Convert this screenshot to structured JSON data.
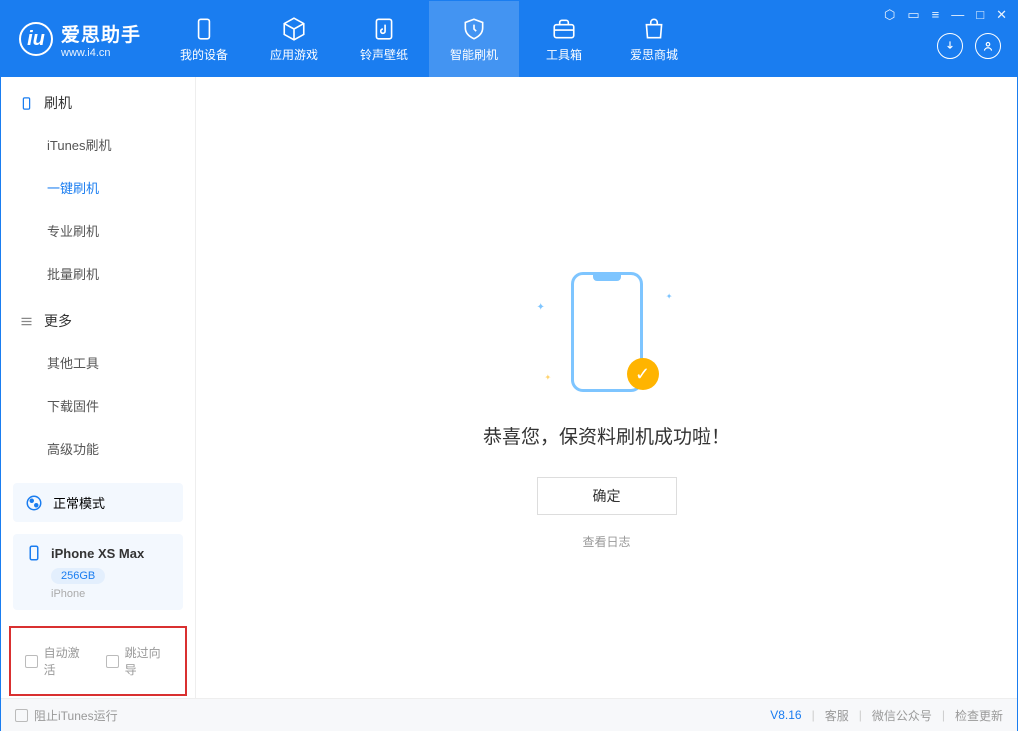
{
  "app": {
    "title": "爱思助手",
    "url": "www.i4.cn"
  },
  "nav": [
    {
      "label": "我的设备",
      "icon": "device"
    },
    {
      "label": "应用游戏",
      "icon": "cube"
    },
    {
      "label": "铃声壁纸",
      "icon": "music"
    },
    {
      "label": "智能刷机",
      "icon": "shield",
      "active": true
    },
    {
      "label": "工具箱",
      "icon": "toolbox"
    },
    {
      "label": "爱思商城",
      "icon": "bag"
    }
  ],
  "sidebar": {
    "sections": [
      {
        "title": "刷机",
        "icon": "phone",
        "items": [
          "iTunes刷机",
          "一键刷机",
          "专业刷机",
          "批量刷机"
        ],
        "activeIndex": 1
      },
      {
        "title": "更多",
        "icon": "list",
        "items": [
          "其他工具",
          "下载固件",
          "高级功能"
        ],
        "activeIndex": -1
      }
    ],
    "mode": {
      "label": "正常模式"
    },
    "device": {
      "name": "iPhone XS Max",
      "capacity": "256GB",
      "type": "iPhone"
    },
    "checks": {
      "autoActivate": "自动激活",
      "skipGuide": "跳过向导"
    }
  },
  "main": {
    "successMsg": "恭喜您，保资料刷机成功啦！",
    "confirmBtn": "确定",
    "viewLog": "查看日志"
  },
  "footer": {
    "blockItunes": "阻止iTunes运行",
    "version": "V8.16",
    "links": [
      "客服",
      "微信公众号",
      "检查更新"
    ]
  }
}
